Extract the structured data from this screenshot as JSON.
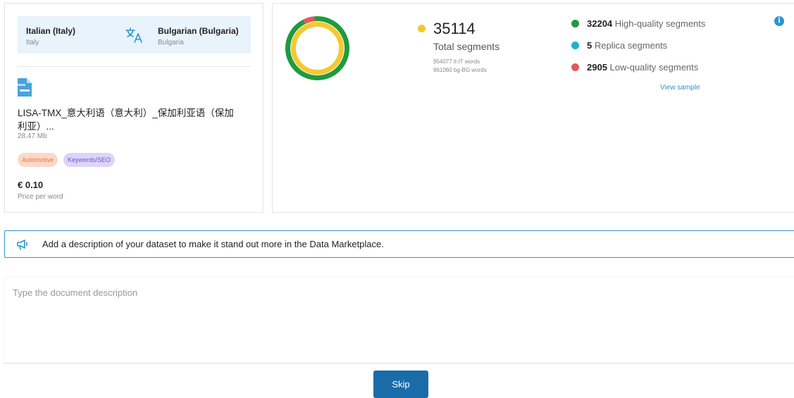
{
  "language_pair": {
    "source": {
      "name": "Italian (Italy)",
      "region": "Italy"
    },
    "target": {
      "name": "Bulgarian (Bulgaria)",
      "region": "Bulgaria"
    },
    "icon": "translate-icon"
  },
  "file": {
    "icon": "document-icon",
    "name": "LISA-TMX_意大利语（意大利）_保加利亚语（保加利亚）...",
    "size": "28.47 Mb"
  },
  "tags": [
    {
      "label": "Automotive",
      "color": "#fbd9c8"
    },
    {
      "label": "Keywords/SEO",
      "color": "#ddd5f8"
    }
  ],
  "price": {
    "value": "€ 0.10",
    "label": "Price per word"
  },
  "stats": {
    "total_segments": "35114",
    "total_label": "Total segments",
    "source_words": "954077 it-IT words",
    "target_words": "961060 bg-BG words",
    "high_quality": {
      "count": "32204",
      "label": "High-quality segments",
      "color": "#1f9a3f"
    },
    "replica": {
      "count": "5",
      "label": "Replica segments",
      "color": "#1bb3c9"
    },
    "low_quality": {
      "count": "2905",
      "label": "Low-quality segments",
      "color": "#e35a5a"
    },
    "view_sample": "View sample",
    "total_color": "#f6c830"
  },
  "notice": {
    "icon": "megaphone-icon",
    "text": "Add a description of your dataset to make it stand out more in the Data Marketplace."
  },
  "description": {
    "placeholder": "Type the document description",
    "value": ""
  },
  "skip_label": "Skip"
}
